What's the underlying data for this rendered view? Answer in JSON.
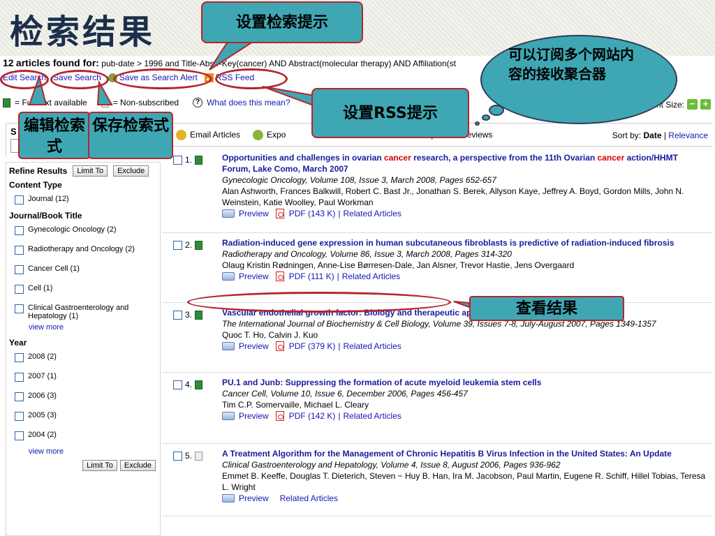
{
  "slide": {
    "title": "检索结果"
  },
  "header": {
    "count": "12",
    "found_label": "articles found for:",
    "query_text": "pub-date > 1996 and Title-Abstr-Key(cancer) AND Abstract(molecular therapy) AND Affiliation(st"
  },
  "actions": {
    "edit_search": "Edit Search",
    "save_search": "Save Search",
    "save_alert": "Save as Search Alert",
    "rss_feed": "RSS Feed"
  },
  "legend": {
    "full_text": "= Full-text available",
    "non_subscribed": "= Non-subscribed",
    "what_means": "What does this mean?",
    "font_size": "Font Size:"
  },
  "toolbar": {
    "email_articles": "Email Articles",
    "export": "Expo",
    "open_previews": "pen All Previews",
    "sort_by": "Sort by:",
    "sort_date": "Date",
    "sort_relevance": "Relevance"
  },
  "sidebar": {
    "search_label": "S",
    "refine_results": "Refine Results",
    "limit_to": "Limit To",
    "exclude": "Exclude",
    "content_type_title": "Content Type",
    "content_types": [
      {
        "label": "Journal (12)"
      }
    ],
    "journal_title": "Journal/Book Title",
    "journals": [
      {
        "label": "Gynecologic Oncology (2)"
      },
      {
        "label": "Radiotherapy and Oncology (2)"
      },
      {
        "label": "Cancer Cell (1)"
      },
      {
        "label": "Cell (1)"
      },
      {
        "label": "Clinical Gastroenterology and Hepatology (1)"
      }
    ],
    "view_more": "view more",
    "year_title": "Year",
    "years": [
      {
        "label": "2008 (2)"
      },
      {
        "label": "2007 (1)"
      },
      {
        "label": "2006 (3)"
      },
      {
        "label": "2005 (3)"
      },
      {
        "label": "2004 (2)"
      }
    ]
  },
  "results": [
    {
      "num": "1.",
      "full_text": true,
      "title_a": "Opportunities and challenges in ovarian ",
      "title_hl1": "cancer",
      "title_b": " research, a perspective from the 11th Ovarian ",
      "title_hl2": "cancer",
      "title_c": " action/HHMT Forum, Lake Como, March 2007",
      "source": "Gynecologic Oncology, Volume 108, Issue 3, March 2008, Pages 652-657",
      "authors": "Alan Ashworth, Frances Balkwill, Robert C. Bast Jr., Jonathan S. Berek, Allyson Kaye, Jeffrey A. Boyd, Gordon Mills, John N. Weinstein, Katie Woolley, Paul Workman",
      "preview": "Preview",
      "pdf": "PDF (143 K)",
      "related": "Related Articles"
    },
    {
      "num": "2.",
      "full_text": true,
      "title": "Radiation-induced gene expression in human subcutaneous fibroblasts is predictive of radiation-induced fibrosis",
      "source": "Radiotherapy and Oncology, Volume 86, Issue 3, March 2008, Pages 314-320",
      "authors": "Olaug Kristin Rødningen, Anne-Lise Børresen-Dale, Jan Alsner, Trevor Hastie, Jens Overgaard",
      "preview": "Preview",
      "pdf": "PDF (111 K)",
      "related": "Related Articles"
    },
    {
      "num": "3.",
      "full_text": true,
      "title": "Vascular endothelial growth factor: Biology and therapeutic applications",
      "source": "The International Journal of Biochemistry & Cell Biology, Volume 39, Issues 7-8, July-August 2007, Pages 1349-1357",
      "authors": "Quoc T. Ho, Calvin J. Kuo",
      "preview": "Preview",
      "pdf": "PDF (379 K)",
      "related": "Related Articles"
    },
    {
      "num": "4.",
      "full_text": true,
      "title": "PU.1 and Junb: Suppressing the formation of acute myeloid leukemia stem cells",
      "source": "Cancer Cell, Volume 10, Issue 6, December 2006, Pages 456-457",
      "authors": "Tim C.P. Somervaille, Michael L. Cleary",
      "preview": "Preview",
      "pdf": "PDF (142 K)",
      "related": "Related Articles"
    },
    {
      "num": "5.",
      "full_text": false,
      "title": "A Treatment Algorithm for the Management of Chronic Hepatitis B Virus Infection in the United States: An Update",
      "source": "Clinical Gastroenterology and Hepatology, Volume 4, Issue 8, August 2006, Pages 936-962",
      "authors": "Emmet B. Keeffe, Douglas T. Dieterich, Steven − Huy B. Han, Ira M. Jacobson, Paul Martin, Eugene R. Schiff, Hillel Tobias, Teresa L. Wright",
      "preview": "Preview",
      "related": "Related Articles"
    }
  ],
  "annotations": {
    "set_alert": "设置检索提示",
    "rss_cloud": "可以订阅多个网站内容的接收聚合器",
    "set_rss": "设置RSS提示",
    "edit_box": "编辑检索式",
    "save_box": "保存检索式",
    "view_results": "查看结果"
  },
  "colors": {
    "callout_fill": "#3fa7b4",
    "highlight_oval": "#b3262d",
    "link": "#1515b5",
    "keyword_highlight": "#d10000"
  }
}
